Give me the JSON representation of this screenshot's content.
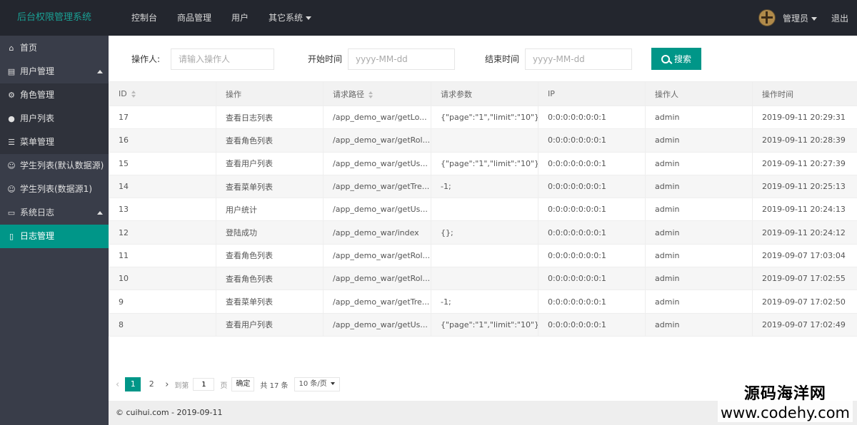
{
  "app": {
    "title": "后台权限管理系统"
  },
  "topnav": {
    "items": [
      "控制台",
      "商品管理",
      "用户",
      "其它系统"
    ]
  },
  "user": {
    "name": "管理员",
    "logout": "退出"
  },
  "sidebar": {
    "home": "首页",
    "user_mgmt": "用户管理",
    "role_mgmt": "角色管理",
    "user_list": "用户列表",
    "menu_mgmt": "菜单管理",
    "student_default": "学生列表(默认数据源)",
    "student_ds1": "学生列表(数据源1)",
    "sys_log": "系统日志",
    "log_mgmt": "日志管理"
  },
  "search": {
    "operator_label": "操作人:",
    "operator_placeholder": "请输入操作人",
    "start_label": "开始时间",
    "start_placeholder": "yyyy-MM-dd",
    "end_label": "结束时间",
    "end_placeholder": "yyyy-MM-dd",
    "button": "搜索"
  },
  "table": {
    "headers": [
      "ID",
      "操作",
      "请求路径",
      "请求参数",
      "IP",
      "操作人",
      "操作时间"
    ],
    "rows": [
      [
        "17",
        "查看日志列表",
        "/app_demo_war/getLo...",
        "{\"page\":\"1\",\"limit\":\"10\"};",
        "0:0:0:0:0:0:0:1",
        "admin",
        "2019-09-11 20:29:31"
      ],
      [
        "16",
        "查看角色列表",
        "/app_demo_war/getRol...",
        "",
        "0:0:0:0:0:0:0:1",
        "admin",
        "2019-09-11 20:28:39"
      ],
      [
        "15",
        "查看用户列表",
        "/app_demo_war/getUs...",
        "{\"page\":\"1\",\"limit\":\"10\"};",
        "0:0:0:0:0:0:0:1",
        "admin",
        "2019-09-11 20:27:39"
      ],
      [
        "14",
        "查看菜单列表",
        "/app_demo_war/getTre...",
        "-1;",
        "0:0:0:0:0:0:0:1",
        "admin",
        "2019-09-11 20:25:13"
      ],
      [
        "13",
        "用户统计",
        "/app_demo_war/getUs...",
        "",
        "0:0:0:0:0:0:0:1",
        "admin",
        "2019-09-11 20:24:13"
      ],
      [
        "12",
        "登陆成功",
        "/app_demo_war/index",
        "{};",
        "0:0:0:0:0:0:0:1",
        "admin",
        "2019-09-11 20:24:12"
      ],
      [
        "11",
        "查看角色列表",
        "/app_demo_war/getRol...",
        "",
        "0:0:0:0:0:0:0:1",
        "admin",
        "2019-09-07 17:03:04"
      ],
      [
        "10",
        "查看角色列表",
        "/app_demo_war/getRol...",
        "",
        "0:0:0:0:0:0:0:1",
        "admin",
        "2019-09-07 17:02:55"
      ],
      [
        "9",
        "查看菜单列表",
        "/app_demo_war/getTre...",
        "-1;",
        "0:0:0:0:0:0:0:1",
        "admin",
        "2019-09-07 17:02:50"
      ],
      [
        "8",
        "查看用户列表",
        "/app_demo_war/getUs...",
        "{\"page\":\"1\",\"limit\":\"10\"};",
        "0:0:0:0:0:0:0:1",
        "admin",
        "2019-09-07 17:02:49"
      ]
    ]
  },
  "pager": {
    "pages": [
      "1",
      "2"
    ],
    "goto_label": "到第",
    "goto_value": "1",
    "page_suffix": "页",
    "confirm": "确定",
    "total": "共 17 条",
    "limit": "10 条/页"
  },
  "footer": {
    "text": "© cuihui.com - 2019-09-11"
  },
  "watermark": {
    "line1": "源码海洋网",
    "line2": "www.codehy.com"
  }
}
